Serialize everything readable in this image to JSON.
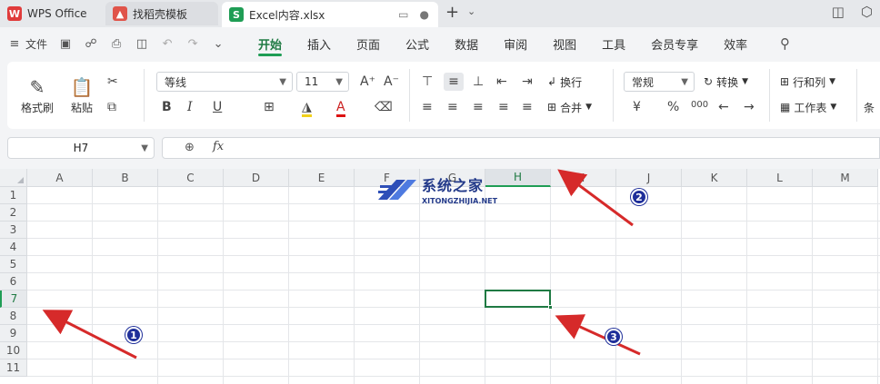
{
  "tabs": {
    "wps_label": "WPS Office",
    "template_label": "找稻壳模板",
    "doc_label": "Excel内容.xlsx",
    "doc_icon_letter": "S",
    "add_glyph": "+",
    "dropdown_glyph": "⌄"
  },
  "menu": {
    "file_label": "文件",
    "tabs": [
      "开始",
      "插入",
      "页面",
      "公式",
      "数据",
      "审阅",
      "视图",
      "工具",
      "会员专享",
      "效率"
    ],
    "active_tab": "开始"
  },
  "ribbon": {
    "format_painter": "格式刷",
    "paste": "粘贴",
    "font_name": "等线",
    "font_size": "11",
    "font_grow": "A⁺",
    "font_shrink": "A⁻",
    "bold": "B",
    "italic": "I",
    "underline": "U",
    "wrap_text": "换行",
    "merge": "合并",
    "number_format": "常规",
    "convert": "转换",
    "currency": "¥",
    "percent": "%",
    "thousands": "000",
    "row_col": "行和列",
    "worksheet": "工作表",
    "conditional": "条"
  },
  "formula_bar": {
    "name_box": "H7",
    "fx": "fx",
    "content": ""
  },
  "grid": {
    "columns": [
      "A",
      "B",
      "C",
      "D",
      "E",
      "F",
      "G",
      "H",
      "I",
      "J",
      "K",
      "L",
      "M"
    ],
    "rows": [
      "1",
      "2",
      "3",
      "4",
      "5",
      "6",
      "7",
      "8",
      "9",
      "10",
      "11"
    ],
    "selected_column": "H",
    "selected_row": "7",
    "accent_color": "#1f7a43"
  },
  "watermark": {
    "title": "系统之家",
    "subtitle": "XITONGZHIJIA.NET"
  },
  "callouts": [
    "1",
    "2",
    "3"
  ],
  "callout_color": "#d62a2a"
}
